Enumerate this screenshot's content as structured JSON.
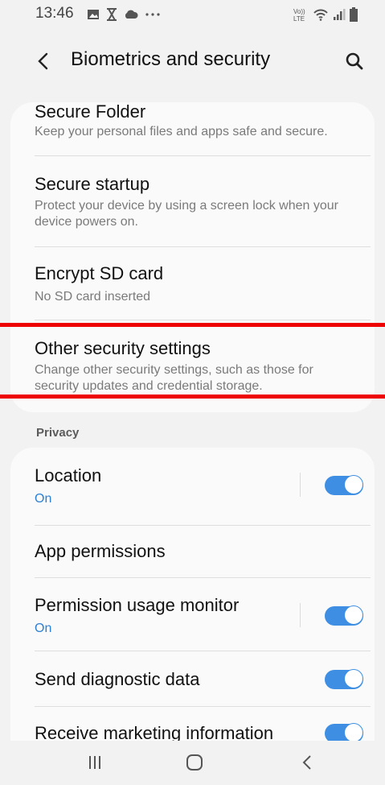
{
  "status_bar": {
    "time": "13:46",
    "icons_left": [
      "image-icon",
      "hourglass-icon",
      "cloud-icon",
      "more-dots-icon"
    ],
    "icons_right": [
      "volte-icon",
      "wifi-icon",
      "signal-icon",
      "battery-icon"
    ],
    "volte_text": "Vo)\nLTE"
  },
  "header": {
    "title": "Biometrics and security",
    "back_icon": "back-arrow-icon",
    "search_icon": "search-icon"
  },
  "security_items": [
    {
      "title": "Secure Folder",
      "subtitle": "Keep your personal files and apps safe and secure."
    },
    {
      "title": "Secure startup",
      "subtitle": "Protect your device by using a screen lock when your device powers on."
    },
    {
      "title": "Encrypt SD card",
      "subtitle": "No SD card inserted"
    },
    {
      "title": "Other security settings",
      "subtitle": "Change other security settings, such as those for security updates and credential storage."
    }
  ],
  "privacy": {
    "section_label": "Privacy",
    "items": [
      {
        "title": "Location",
        "status": "On",
        "toggle": true
      },
      {
        "title": "App permissions"
      },
      {
        "title": "Permission usage monitor",
        "status": "On",
        "toggle": true
      },
      {
        "title": "Send diagnostic data",
        "toggle": true
      },
      {
        "title": "Receive marketing information",
        "toggle": true
      }
    ]
  },
  "nav_bar": {
    "icons": [
      "recents-icon",
      "home-icon",
      "back-icon"
    ]
  },
  "colors": {
    "accent": "#3e8fe3",
    "status_on": "#2d7fd4",
    "highlight": "#ee0000",
    "background": "#f2f2f2",
    "card": "#fafafa"
  }
}
